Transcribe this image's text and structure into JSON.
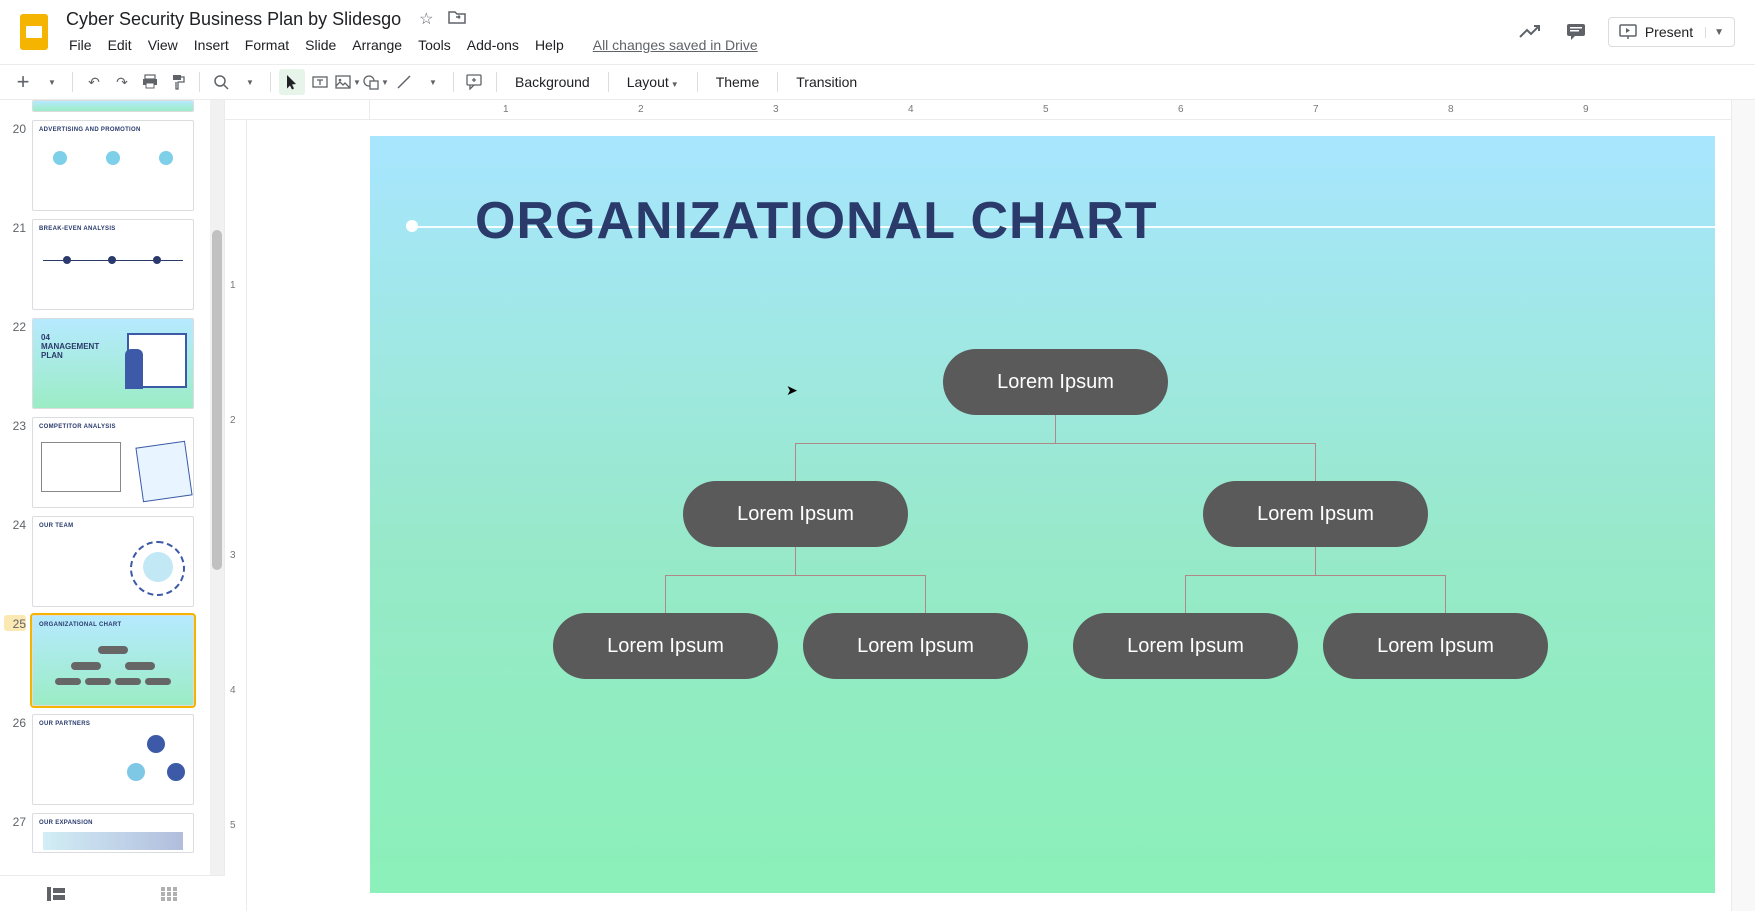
{
  "doc": {
    "title": "Cyber Security Business Plan by Slidesgo",
    "save_status": "All changes saved in Drive"
  },
  "menus": [
    "File",
    "Edit",
    "View",
    "Insert",
    "Format",
    "Slide",
    "Arrange",
    "Tools",
    "Add-ons",
    "Help"
  ],
  "present_label": "Present",
  "toolbar": {
    "background": "Background",
    "layout": "Layout",
    "theme": "Theme",
    "transition": "Transition"
  },
  "ruler_h": [
    "1",
    "2",
    "3",
    "4",
    "5",
    "6",
    "7",
    "8",
    "9"
  ],
  "ruler_v": [
    "1",
    "2",
    "3",
    "4",
    "5"
  ],
  "filmstrip": [
    {
      "num": "20",
      "title": "ADVERTISING AND PROMOTION",
      "bg": "white"
    },
    {
      "num": "21",
      "title": "BREAK-EVEN ANALYSIS",
      "bg": "white"
    },
    {
      "num": "22",
      "title": "04 MANAGEMENT PLAN",
      "bg": "grad"
    },
    {
      "num": "23",
      "title": "COMPETITOR ANALYSIS",
      "bg": "white"
    },
    {
      "num": "24",
      "title": "OUR TEAM",
      "bg": "white"
    },
    {
      "num": "25",
      "title": "ORGANIZATIONAL CHART",
      "bg": "grad",
      "current": true
    },
    {
      "num": "26",
      "title": "OUR PARTNERS",
      "bg": "white"
    },
    {
      "num": "27",
      "title": "OUR EXPANSION",
      "bg": "white"
    }
  ],
  "slide": {
    "title": "ORGANIZATIONAL CHART",
    "nodes": {
      "top": "Lorem Ipsum",
      "l2": [
        "Lorem Ipsum",
        "Lorem Ipsum"
      ],
      "l3": [
        "Lorem Ipsum",
        "Lorem Ipsum",
        "Lorem Ipsum",
        "Lorem Ipsum"
      ]
    }
  }
}
